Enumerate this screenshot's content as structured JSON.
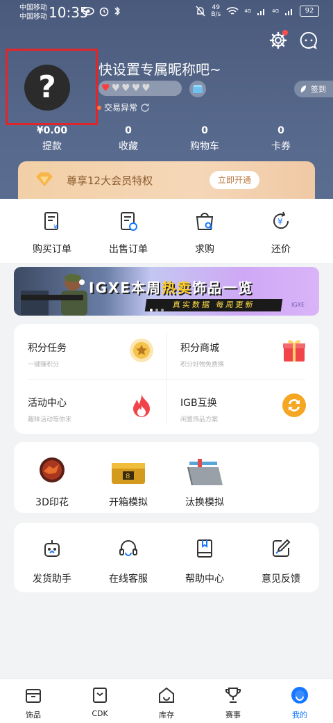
{
  "status_bar": {
    "carrier_1": "中国移动",
    "carrier_2": "中国移动",
    "time": "10:35",
    "net_speed": "49",
    "net_unit": "B/s",
    "signal_1": "4G",
    "signal_2": "4G",
    "battery": "92"
  },
  "profile": {
    "avatar_glyph": "?",
    "nickname": "快设置专属昵称吧~",
    "hearts_filled": 1,
    "hearts_total": 5,
    "checkin_label": "签到",
    "trade_status": "交易异常"
  },
  "stats": [
    {
      "value": "¥0.00",
      "label": "提款"
    },
    {
      "value": "0",
      "label": "收藏"
    },
    {
      "value": "0",
      "label": "购物车"
    },
    {
      "value": "0",
      "label": "卡券"
    }
  ],
  "vip": {
    "text": "尊享12大会员特权",
    "button": "立即开通"
  },
  "orders": [
    {
      "label": "购买订单",
      "icon": "purchase-order-icon"
    },
    {
      "label": "出售订单",
      "icon": "sell-order-icon"
    },
    {
      "label": "求购",
      "icon": "wanted-bag-icon"
    },
    {
      "label": "还价",
      "icon": "counter-offer-icon"
    }
  ],
  "banner": {
    "title_a": "IGXE本周",
    "title_hl": "热卖",
    "title_b": "饰品一览",
    "subtitle": "真实数据 每周更新",
    "logo": "IGXE"
  },
  "features": [
    {
      "title": "积分任务",
      "sub": "一键赚积分",
      "icon": "star-coin-icon",
      "color": "#f5c24b"
    },
    {
      "title": "积分商城",
      "sub": "积分好物免费换",
      "icon": "gift-box-icon",
      "color": "#f0444a"
    },
    {
      "title": "活动中心",
      "sub": "趣味活动等你来",
      "icon": "flame-icon",
      "color": "#f0444a"
    },
    {
      "title": "IGB互换",
      "sub": "闲置饰品方案",
      "icon": "exchange-icon",
      "color": "#f5a623"
    }
  ],
  "tools": [
    {
      "label": "3D印花",
      "icon": "sticker-3d-icon"
    },
    {
      "label": "开箱模拟",
      "icon": "case-open-icon"
    },
    {
      "label": "汰换模拟",
      "icon": "trade-up-icon"
    }
  ],
  "services": [
    {
      "label": "发货助手",
      "icon": "robot-icon"
    },
    {
      "label": "在线客服",
      "icon": "headset-icon"
    },
    {
      "label": "帮助中心",
      "icon": "book-icon"
    },
    {
      "label": "意见反馈",
      "icon": "feedback-pen-icon"
    }
  ],
  "bottom_nav": [
    {
      "label": "饰品",
      "icon": "inventory-box-icon"
    },
    {
      "label": "CDK",
      "icon": "cdk-icon"
    },
    {
      "label": "库存",
      "icon": "storage-icon"
    },
    {
      "label": "赛事",
      "icon": "trophy-icon"
    },
    {
      "label": "我的",
      "icon": "profile-icon",
      "active": true
    }
  ],
  "colors": {
    "header_bg": "#56688b",
    "accent": "#1677ff",
    "red": "#e1262b",
    "vip_text": "#8a5a2c"
  }
}
